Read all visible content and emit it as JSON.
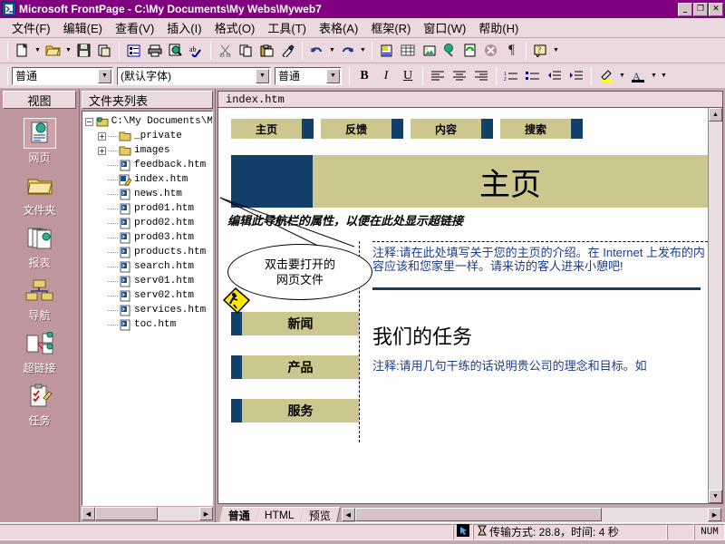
{
  "window": {
    "title": "Microsoft FrontPage - C:\\My Documents\\My Webs\\Myweb7",
    "icon": "frontpage-icon",
    "minimize": "_",
    "restore": "❐",
    "close": "✕"
  },
  "menu": [
    {
      "label": "文件(F)"
    },
    {
      "label": "编辑(E)"
    },
    {
      "label": "查看(V)"
    },
    {
      "label": "插入(I)"
    },
    {
      "label": "格式(O)"
    },
    {
      "label": "工具(T)"
    },
    {
      "label": "表格(A)"
    },
    {
      "label": "框架(R)"
    },
    {
      "label": "窗口(W)"
    },
    {
      "label": "帮助(H)"
    }
  ],
  "standard_toolbar": [
    {
      "name": "new-page-button",
      "glyph": "🗋"
    },
    {
      "name": "new-page-dropdown",
      "glyph": "▾"
    },
    {
      "name": "open-button",
      "glyph": "📂"
    },
    {
      "name": "open-dropdown",
      "glyph": "▾"
    },
    {
      "name": "save-button",
      "glyph": "💾"
    },
    {
      "name": "publish-button",
      "glyph": "🗐"
    },
    {
      "name": "sep1",
      "glyph": ""
    },
    {
      "name": "folder-list-button",
      "glyph": "▤"
    },
    {
      "name": "print-button",
      "glyph": "🖶"
    },
    {
      "name": "print-preview-button",
      "glyph": "🔍"
    },
    {
      "name": "spelling-button",
      "glyph": "✓"
    },
    {
      "name": "sep2",
      "glyph": ""
    },
    {
      "name": "cut-button",
      "glyph": "✂"
    },
    {
      "name": "copy-button",
      "glyph": "🗐"
    },
    {
      "name": "paste-button",
      "glyph": "📋"
    },
    {
      "name": "format-painter-button",
      "glyph": "🖌"
    },
    {
      "name": "sep3",
      "glyph": ""
    },
    {
      "name": "undo-button",
      "glyph": "↶"
    },
    {
      "name": "undo-dropdown",
      "glyph": "▾"
    },
    {
      "name": "redo-button",
      "glyph": "↷"
    },
    {
      "name": "redo-dropdown",
      "glyph": "▾"
    },
    {
      "name": "sep4",
      "glyph": ""
    },
    {
      "name": "insert-component-button",
      "glyph": "🗒"
    },
    {
      "name": "insert-table-button",
      "glyph": "▦"
    },
    {
      "name": "insert-picture-button",
      "glyph": "🖼"
    },
    {
      "name": "insert-hyperlink-button",
      "glyph": "🌐"
    },
    {
      "name": "refresh-button",
      "glyph": "♻"
    },
    {
      "name": "stop-button",
      "glyph": "✖"
    },
    {
      "name": "show-paragraph-marks-button",
      "glyph": "¶"
    },
    {
      "name": "sep5",
      "glyph": ""
    },
    {
      "name": "help-button",
      "glyph": "❓"
    },
    {
      "name": "help-dropdown",
      "glyph": "▾"
    }
  ],
  "format_toolbar": {
    "style_value": "普通",
    "font_value": "(默认字体)",
    "size_value": "普通",
    "bold_label": "B",
    "italic_label": "I",
    "underline_label": "U",
    "align_left": "▤",
    "align_center": "▤",
    "align_right": "▤",
    "numbered_list": "☰",
    "bulleted_list": "☷",
    "decrease_indent": "⇤",
    "increase_indent": "⇥",
    "highlight": "🖍",
    "highlight_dropdown": "▾",
    "font_color": "A",
    "font_color_dropdown": "▾",
    "more_dropdown": "▾"
  },
  "views": {
    "header": "视图",
    "items": [
      {
        "label": "网页",
        "icon": "page-view-icon",
        "selected": true
      },
      {
        "label": "文件夹",
        "icon": "folders-view-icon",
        "selected": false
      },
      {
        "label": "报表",
        "icon": "reports-view-icon",
        "selected": false
      },
      {
        "label": "导航",
        "icon": "navigation-view-icon",
        "selected": false
      },
      {
        "label": "超链接",
        "icon": "hyperlinks-view-icon",
        "selected": false
      },
      {
        "label": "任务",
        "icon": "tasks-view-icon",
        "selected": false
      }
    ]
  },
  "folder_list": {
    "header": "文件夹列表",
    "root": {
      "label": "C:\\My Documents\\M",
      "expander": "−",
      "icon": "open-web-folder-icon"
    },
    "items": [
      {
        "label": "_private",
        "icon": "folder-icon",
        "expander": "+",
        "indent": 1
      },
      {
        "label": "images",
        "icon": "folder-icon",
        "expander": "+",
        "indent": 1
      },
      {
        "label": "feedback.htm",
        "icon": "html-page-icon",
        "expander": "",
        "indent": 1
      },
      {
        "label": "index.htm",
        "icon": "html-page-open-icon",
        "expander": "",
        "indent": 1
      },
      {
        "label": "news.htm",
        "icon": "html-page-icon",
        "expander": "",
        "indent": 1
      },
      {
        "label": "prod01.htm",
        "icon": "html-page-icon",
        "expander": "",
        "indent": 1
      },
      {
        "label": "prod02.htm",
        "icon": "html-page-icon",
        "expander": "",
        "indent": 1
      },
      {
        "label": "prod03.htm",
        "icon": "html-page-icon",
        "expander": "",
        "indent": 1
      },
      {
        "label": "products.htm",
        "icon": "html-page-icon",
        "expander": "",
        "indent": 1
      },
      {
        "label": "search.htm",
        "icon": "html-page-icon",
        "expander": "",
        "indent": 1
      },
      {
        "label": "serv01.htm",
        "icon": "html-page-icon",
        "expander": "",
        "indent": 1
      },
      {
        "label": "serv02.htm",
        "icon": "html-page-icon",
        "expander": "",
        "indent": 1
      },
      {
        "label": "services.htm",
        "icon": "html-page-icon",
        "expander": "",
        "indent": 1
      },
      {
        "label": "toc.htm",
        "icon": "html-page-icon",
        "expander": "",
        "indent": 1
      }
    ]
  },
  "document": {
    "tab_label": "index.htm",
    "top_nav": [
      {
        "label": "主页"
      },
      {
        "label": "反馈"
      },
      {
        "label": "内容"
      },
      {
        "label": "搜索"
      }
    ],
    "banner_title": "主页",
    "nav_hint": "编辑此导航栏的属性，以便在此处显示超链接",
    "intro_comment": "注释:请在此处填写关于您的主页的介绍。在 Internet 上发布的内容应该和您家里一样。请来访的客人进来小憩吧!",
    "side_nav": [
      {
        "label": "新闻"
      },
      {
        "label": "产品"
      },
      {
        "label": "服务"
      }
    ],
    "mission_heading": "我们的任务",
    "mission_comment": "注释:请用几句干练的话说明贵公司的理念和目标。如"
  },
  "callout": {
    "line1": "双击要打开的",
    "line2": "网页文件",
    "icon": "construction-sign-icon"
  },
  "view_tabs": [
    {
      "label": "普通",
      "active": true
    },
    {
      "label": "HTML",
      "active": false
    },
    {
      "label": "预览",
      "active": false
    }
  ],
  "status_bar": {
    "cursor_icon": "pointer-icon",
    "timer_icon": "hourglass-icon",
    "transfer_text": "传输方式: 28.8，时间: 4 秒",
    "num_lock": "NUM"
  },
  "colors": {
    "titlebar": "#800080",
    "toolbar_bg": "#ecd9e0",
    "views_bg": "#c0969e",
    "panel_bg": "#c0a8ad",
    "theme_tan": "#ccc68f",
    "theme_navy": "#13406b",
    "comment_blue": "#1a3d8f"
  }
}
